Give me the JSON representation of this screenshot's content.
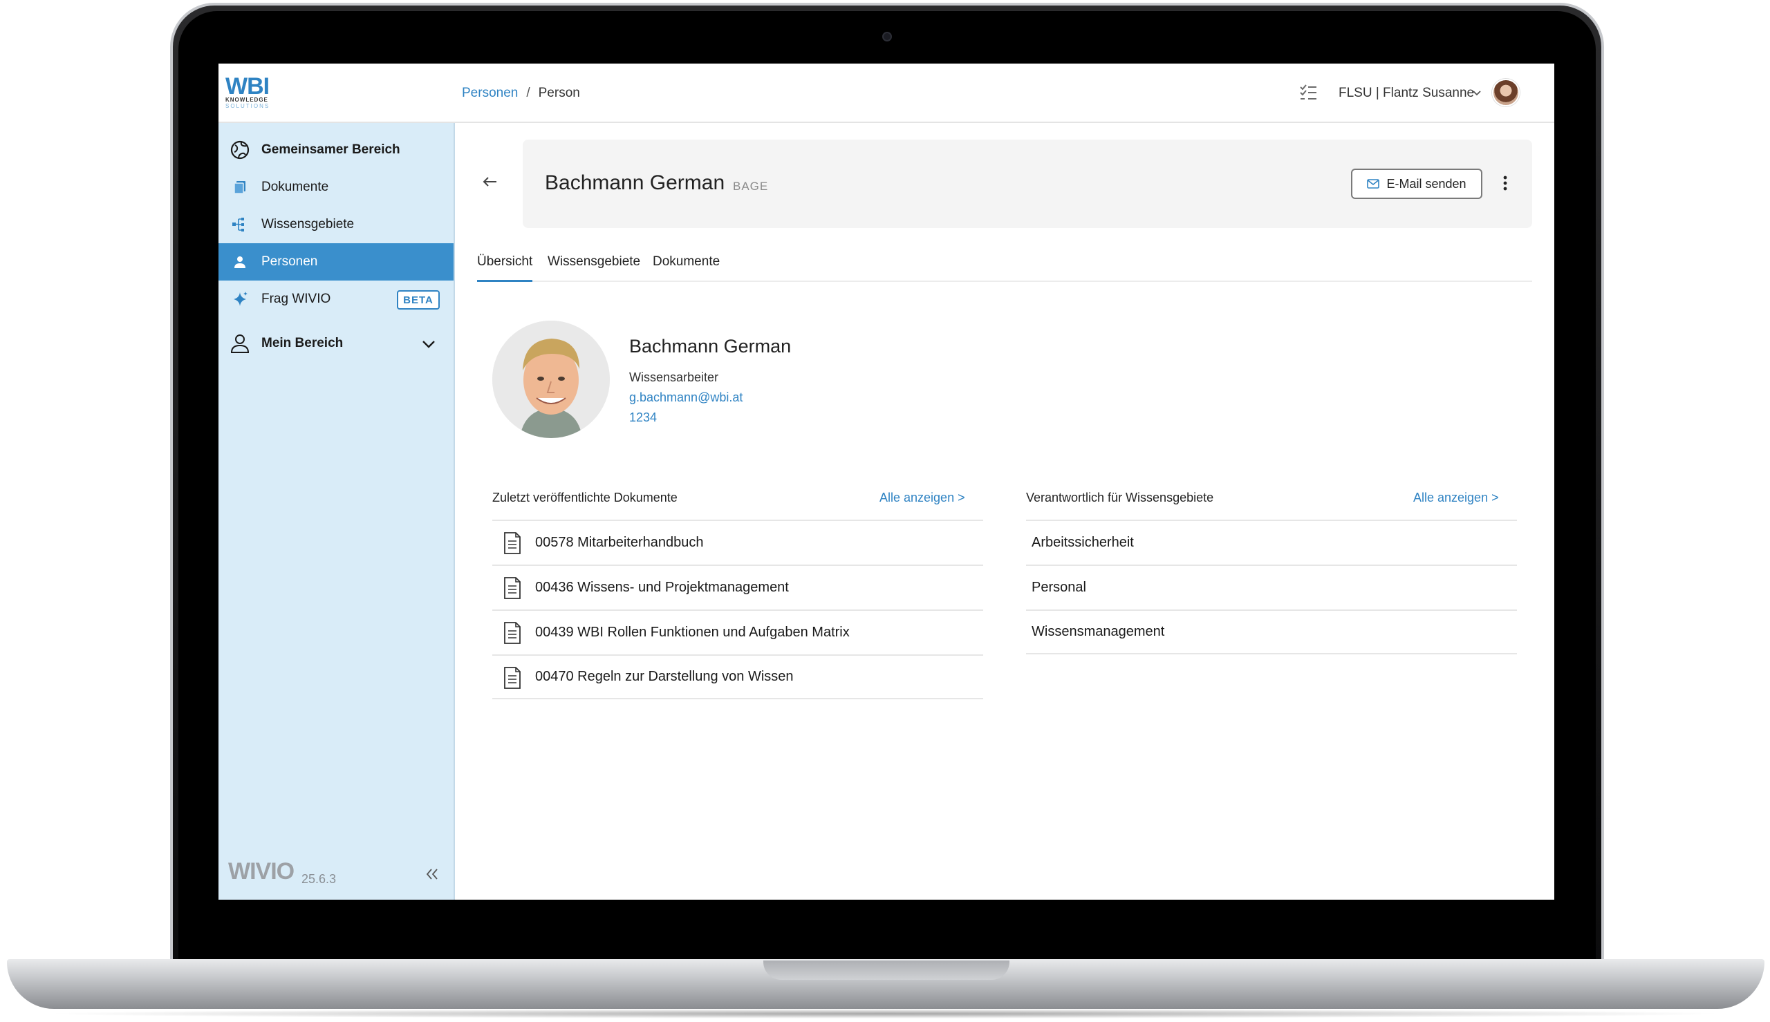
{
  "topbar": {
    "logo_main": "WBI",
    "logo_sub1": "KNOWLEDGE",
    "logo_sub2": "SOLUTIONS",
    "breadcrumb": [
      {
        "label": "Personen"
      },
      {
        "label": "Person"
      }
    ],
    "breadcrumb_separator": "/",
    "user_label": "FLSU | Flantz Susanne"
  },
  "sidebar": {
    "group_shared": "Gemeinsamer Bereich",
    "items": [
      {
        "label": "Dokumente",
        "icon": "documents-icon"
      },
      {
        "label": "Wissensgebiete",
        "icon": "knowledge-tree-icon"
      },
      {
        "label": "Personen",
        "icon": "person-icon",
        "active": true
      },
      {
        "label": "Frag WIVIO",
        "icon": "sparkle-icon",
        "badge": "BETA"
      }
    ],
    "group_personal": "Mein Bereich",
    "brand": "WIVIO",
    "version": "25.6.3"
  },
  "header": {
    "title": "Bachmann German",
    "code": "BAGE",
    "email_button": "E-Mail senden"
  },
  "tabs": [
    {
      "label": "Übersicht",
      "active": true
    },
    {
      "label": "Wissensgebiete"
    },
    {
      "label": "Dokumente"
    }
  ],
  "profile": {
    "name": "Bachmann German",
    "role": "Wissensarbeiter",
    "email": "g.bachmann@wbi.at",
    "phone": "1234"
  },
  "documents_section": {
    "heading": "Zuletzt veröffentlichte Dokumente",
    "link": "Alle anzeigen >",
    "items": [
      {
        "label": "00578  Mitarbeiterhandbuch"
      },
      {
        "label": "00436  Wissens- und Projektmanagement"
      },
      {
        "label": "00439  WBI Rollen Funktionen und Aufgaben Matrix"
      },
      {
        "label": "00470  Regeln zur Darstellung von Wissen"
      }
    ]
  },
  "knowledge_section": {
    "heading": "Verantwortlich für Wissensgebiete",
    "link": "Alle anzeigen >",
    "items": [
      {
        "label": "Arbeitssicherheit"
      },
      {
        "label": "Personal"
      },
      {
        "label": "Wissensmanagement"
      }
    ]
  },
  "colors": {
    "accent": "#2f83c3",
    "sidebar_bg": "#d9ecf8",
    "sidebar_active": "#3a8fcc",
    "header_card": "#f4f4f4"
  }
}
